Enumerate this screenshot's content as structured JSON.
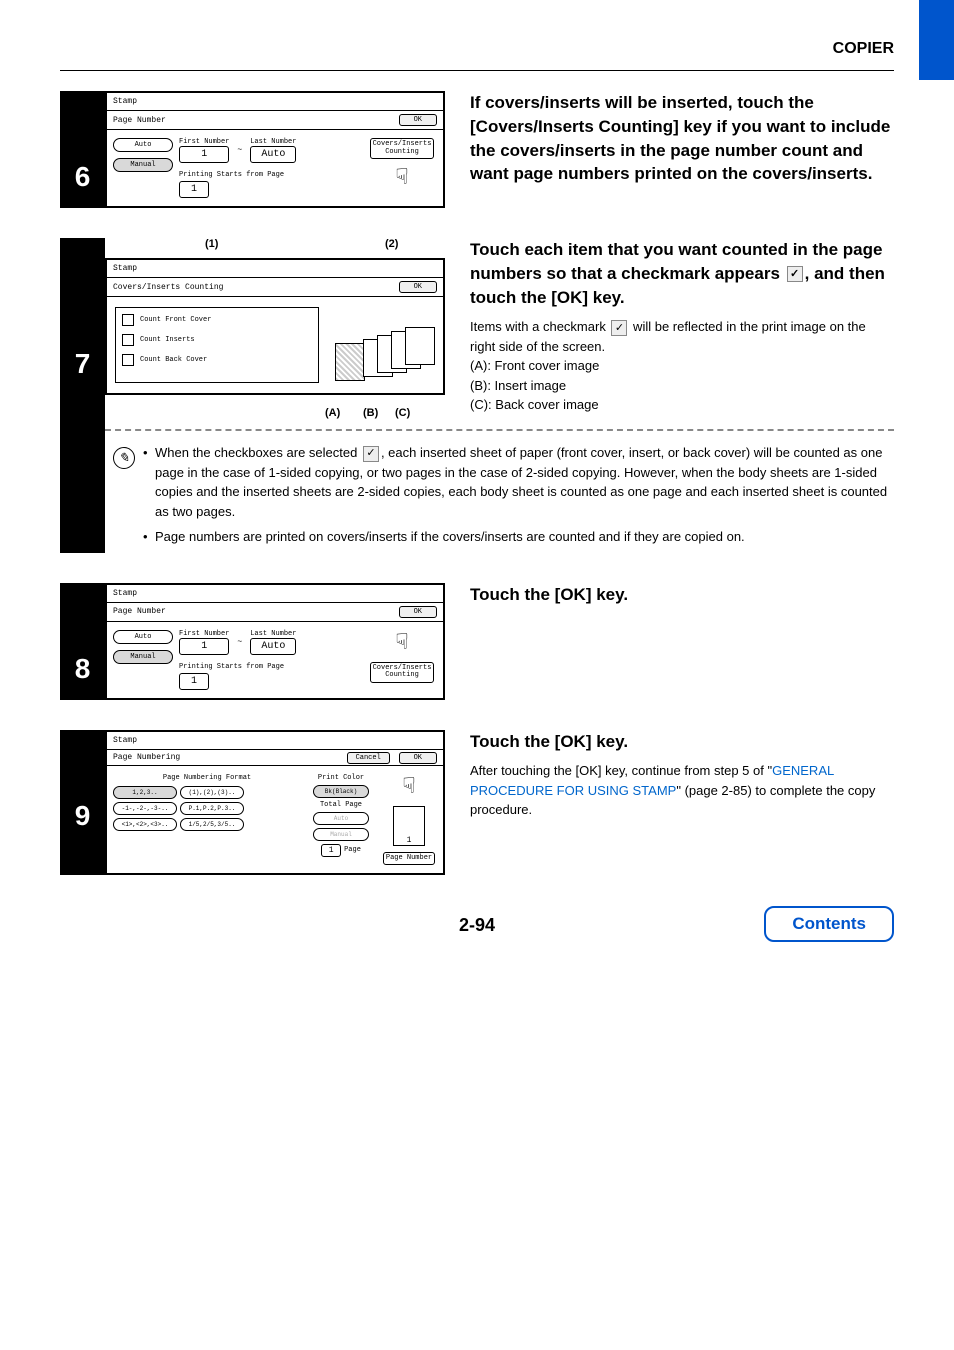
{
  "header": {
    "title": "COPIER"
  },
  "step6": {
    "num": "6",
    "panel": {
      "title": "Stamp",
      "subtitle": "Page Number",
      "ok": "OK",
      "auto": "Auto",
      "manual": "Manual",
      "first_lbl": "First Number",
      "last_lbl": "Last Number",
      "first_val": "1",
      "tilde": "~",
      "auto_btn": "Auto",
      "starts_lbl": "Printing Starts from Page",
      "starts_val": "1",
      "covers_btn": "Covers/Inserts\nCounting"
    },
    "instr": "If covers/inserts will be inserted, touch the [Covers/Inserts Counting] key if you want to include the covers/inserts in the page number count and want page numbers printed on the covers/inserts."
  },
  "step7": {
    "num": "7",
    "callouts": {
      "c1": "(1)",
      "c2": "(2)",
      "cA": "(A)",
      "cB": "(B)",
      "cC": "(C)"
    },
    "panel": {
      "title": "Stamp",
      "subtitle": "Covers/Inserts Counting",
      "ok": "OK",
      "items": [
        "Count Front Cover",
        "Count Inserts",
        "Count Back Cover"
      ]
    },
    "instr_a": "Touch each item that you want counted in the page numbers so that a checkmark appears ",
    "instr_b": ", and then touch the [OK] key.",
    "body1": "Items with a checkmark ",
    "body2": " will be reflected in the print image on the right side of the screen.",
    "lineA": "(A): Front cover image",
    "lineB": "(B): Insert image",
    "lineC": "(C): Back cover image",
    "notes": {
      "n1": "When the checkboxes are selected ",
      "n1b": ", each inserted sheet of paper (front cover, insert, or back cover) will be counted as one page in the case of 1-sided copying, or two pages in the case of 2-sided copying. However, when the body sheets are 1-sided copies and the inserted sheets are 2-sided copies, each body sheet is counted as one page and each inserted sheet is counted as two pages.",
      "n2": "Page numbers are printed on covers/inserts if the covers/inserts are counted and if they are copied on."
    }
  },
  "step8": {
    "num": "8",
    "instr": "Touch the [OK] key.",
    "panel": {
      "title": "Stamp",
      "subtitle": "Page Number",
      "ok": "OK",
      "auto": "Auto",
      "manual": "Manual",
      "first_lbl": "First Number",
      "last_lbl": "Last Number",
      "first_val": "1",
      "tilde": "~",
      "auto_btn": "Auto",
      "starts_lbl": "Printing Starts from Page",
      "starts_val": "1",
      "covers_btn": "Covers/Inserts\nCounting"
    }
  },
  "step9": {
    "num": "9",
    "instr": "Touch the [OK] key.",
    "body_a": "After touching the [OK] key, continue from step 5 of \"",
    "link": "GENERAL PROCEDURE FOR USING STAMP",
    "body_b": "\" (page 2-85) to complete the copy procedure.",
    "panel": {
      "title": "Stamp",
      "subtitle": "Page Numbering",
      "cancel": "Cancel",
      "ok": "OK",
      "format_lbl": "Page Numbering Format",
      "formats": [
        "1,2,3..",
        "(1),(2),(3)..",
        "-1-,-2-,-3-..",
        "P.1,P.2,P.3..",
        "<1>,<2>,<3>..",
        "1/5,2/5,3/5.."
      ],
      "print_color_lbl": "Print Color",
      "print_color_val": "Bk(Black)",
      "total_lbl": "Total Page",
      "auto_btn": "Auto",
      "manual_btn": "Manual",
      "page_val": "1",
      "page_lbl": "Page",
      "preview_val": "1",
      "pn_btn": "Page Number"
    }
  },
  "footer": {
    "page": "2-94",
    "contents": "Contents"
  }
}
